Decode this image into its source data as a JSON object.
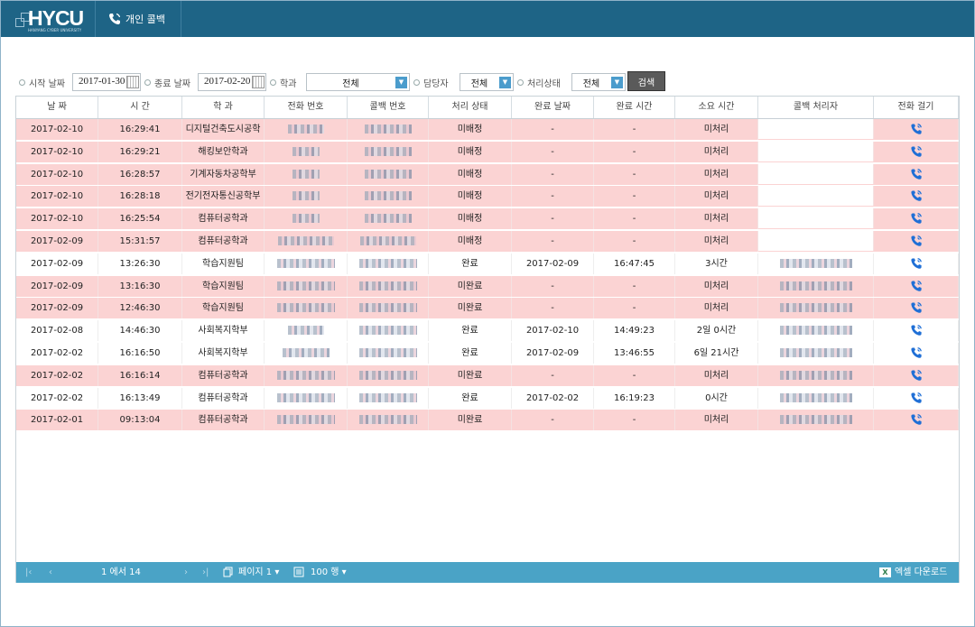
{
  "header": {
    "logo_text": "HYCU",
    "logo_sub": "HANYANG CYBER UNIVERSITY",
    "menu_label": "개인 콜백"
  },
  "filters": {
    "start_label": "시작 날짜",
    "start_value": "2017-01-30",
    "end_label": "종료 날짜",
    "end_value": "2017-02-20",
    "dept_label": "학과",
    "dept_value": "전체",
    "manager_label": "담당자",
    "manager_value": "전체",
    "status_label": "처리상태",
    "status_value": "전체",
    "search_label": "검색"
  },
  "table": {
    "columns": [
      "날 짜",
      "시 간",
      "학 과",
      "전화 번호",
      "콜백 번호",
      "처리 상태",
      "완료 날짜",
      "완료 시간",
      "소요 시간",
      "콜백 처리자",
      "전화 걸기"
    ],
    "rows": [
      {
        "date": "2017-02-10",
        "time": "16:29:41",
        "dept": "디지털건축도시공학",
        "status": "미배정",
        "done_date": "-",
        "done_time": "-",
        "elapsed": "미처리",
        "state": "pink"
      },
      {
        "date": "2017-02-10",
        "time": "16:29:21",
        "dept": "해킹보안학과",
        "status": "미배정",
        "done_date": "-",
        "done_time": "-",
        "elapsed": "미처리",
        "state": "pink"
      },
      {
        "date": "2017-02-10",
        "time": "16:28:57",
        "dept": "기계자동차공학부",
        "status": "미배정",
        "done_date": "-",
        "done_time": "-",
        "elapsed": "미처리",
        "state": "pink"
      },
      {
        "date": "2017-02-10",
        "time": "16:28:18",
        "dept": "전기전자통신공학부",
        "status": "미배정",
        "done_date": "-",
        "done_time": "-",
        "elapsed": "미처리",
        "state": "pink"
      },
      {
        "date": "2017-02-10",
        "time": "16:25:54",
        "dept": "컴퓨터공학과",
        "status": "미배정",
        "done_date": "-",
        "done_time": "-",
        "elapsed": "미처리",
        "state": "pink"
      },
      {
        "date": "2017-02-09",
        "time": "15:31:57",
        "dept": "컴퓨터공학과",
        "status": "미배정",
        "done_date": "-",
        "done_time": "-",
        "elapsed": "미처리",
        "state": "pink"
      },
      {
        "date": "2017-02-09",
        "time": "13:26:30",
        "dept": "학습지원팀",
        "status": "완료",
        "done_date": "2017-02-09",
        "done_time": "16:47:45",
        "elapsed": "3시간",
        "state": "white"
      },
      {
        "date": "2017-02-09",
        "time": "13:16:30",
        "dept": "학습지원팀",
        "status": "미완료",
        "done_date": "-",
        "done_time": "-",
        "elapsed": "미처리",
        "state": "pink"
      },
      {
        "date": "2017-02-09",
        "time": "12:46:30",
        "dept": "학습지원팀",
        "status": "미완료",
        "done_date": "-",
        "done_time": "-",
        "elapsed": "미처리",
        "state": "pink"
      },
      {
        "date": "2017-02-08",
        "time": "14:46:30",
        "dept": "사회복지학부",
        "status": "완료",
        "done_date": "2017-02-10",
        "done_time": "14:49:23",
        "elapsed": "2일 0시간",
        "state": "white"
      },
      {
        "date": "2017-02-02",
        "time": "16:16:50",
        "dept": "사회복지학부",
        "status": "완료",
        "done_date": "2017-02-09",
        "done_time": "13:46:55",
        "elapsed": "6일 21시간",
        "state": "white"
      },
      {
        "date": "2017-02-02",
        "time": "16:16:14",
        "dept": "컴퓨터공학과",
        "status": "미완료",
        "done_date": "-",
        "done_time": "-",
        "elapsed": "미처리",
        "state": "pink"
      },
      {
        "date": "2017-02-02",
        "time": "16:13:49",
        "dept": "컴퓨터공학과",
        "status": "완료",
        "done_date": "2017-02-02",
        "done_time": "16:19:23",
        "elapsed": "0시간",
        "state": "white"
      },
      {
        "date": "2017-02-01",
        "time": "09:13:04",
        "dept": "컴퓨터공학과",
        "status": "미완료",
        "done_date": "-",
        "done_time": "-",
        "elapsed": "미처리",
        "state": "pink"
      }
    ]
  },
  "pager": {
    "range": "1 에서 14",
    "page": "페이지 1",
    "rows": "100 행",
    "excel": "엑셀 다운로드"
  },
  "colors": {
    "topbar": "#1e6486",
    "pink_row": "#fbd3d3",
    "pager": "#4aa3c6",
    "call_icon": "#1f6fd6"
  },
  "icons": [
    "phone-icon",
    "calendar-icon",
    "dropdown-arrow-icon",
    "call-icon",
    "first-page-icon",
    "prev-page-icon",
    "next-page-icon",
    "last-page-icon",
    "copy-icon",
    "list-icon",
    "excel-icon"
  ]
}
